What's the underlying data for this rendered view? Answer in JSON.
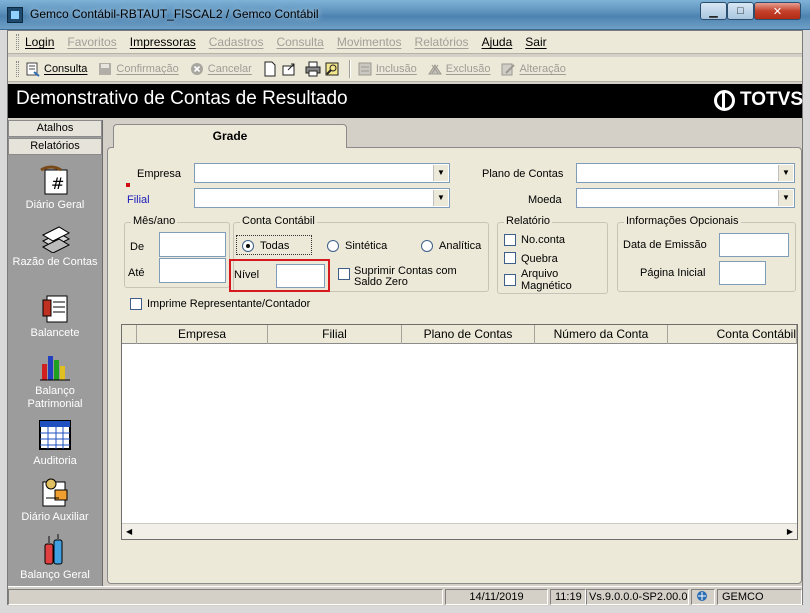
{
  "window": {
    "title": "Gemco Contábil-RBTAUT_FISCAL2 / Gemco Contábil",
    "minimize_label": "▁",
    "maximize_label": "□",
    "close_label": "✕"
  },
  "menu": {
    "items": [
      {
        "label": "Login",
        "enabled": true
      },
      {
        "label": "Favoritos",
        "enabled": false
      },
      {
        "label": "Impressoras",
        "enabled": true
      },
      {
        "label": "Cadastros",
        "enabled": false
      },
      {
        "label": "Consulta",
        "enabled": false
      },
      {
        "label": "Movimentos",
        "enabled": false
      },
      {
        "label": "Relatórios",
        "enabled": false
      },
      {
        "label": "Ajuda",
        "enabled": true
      },
      {
        "label": "Sair",
        "enabled": true
      }
    ]
  },
  "toolbar": {
    "consulta": "Consulta",
    "confirmacao": "Confirmação",
    "cancelar": "Cancelar",
    "inclusao": "Inclusão",
    "exclusao": "Exclusão",
    "alteracao": "Alteração"
  },
  "header": {
    "title": "Demonstrativo de Contas de Resultado",
    "brand": "TOTVS"
  },
  "left_panel": {
    "atalhos": "Atalhos",
    "relatorios": "Relatórios",
    "items": [
      {
        "label": "Diário Geral",
        "icon": "ledger-hash-icon"
      },
      {
        "label": "Razão de Contas",
        "icon": "stacked-books-icon"
      },
      {
        "label": "Balancete",
        "icon": "balance-sheet-icon"
      },
      {
        "label": "Balanço Patrimonial",
        "icon": "bar-chart-icon"
      },
      {
        "label": "Auditoria",
        "icon": "grid-table-icon"
      },
      {
        "label": "Diário Auxiliar",
        "icon": "auxiliary-journal-icon"
      },
      {
        "label": "Balanço Geral",
        "icon": "bottles-icon"
      }
    ]
  },
  "tab": {
    "label": "Grade"
  },
  "form": {
    "empresa_label": "Empresa",
    "filial_label": "Filial",
    "plano_contas_label": "Plano de Contas",
    "moeda_label": "Moeda",
    "mes_ano": {
      "title": "Mês/ano",
      "de_label": "De",
      "ate_label": "Até"
    },
    "conta_contabil": {
      "title": "Conta Contábil",
      "todas": "Todas",
      "sintetica": "Sintética",
      "analitica": "Analítica",
      "selected": "Todas",
      "nivel_label": "Nível",
      "suprimir_label": "Suprimir Contas com Saldo Zero"
    },
    "relatorio": {
      "title": "Relatório",
      "no_conta": "No.conta",
      "quebra": "Quebra",
      "arquivo_magnetico": "Arquivo Magnético"
    },
    "info_opcionais": {
      "title": "Informações Opcionais",
      "data_emissao_label": "Data de Emissão",
      "pagina_inicial_label": "Página Inicial"
    },
    "imprime_label": "Imprime Representante/Contador"
  },
  "grid": {
    "columns": [
      "Empresa",
      "Filial",
      "Plano de Contas",
      "Número da Conta",
      "Conta Contábil"
    ]
  },
  "status": {
    "date": "14/11/2019",
    "time": "11:19",
    "version": "Vs.9.0.0.0-SP2.00.0",
    "user": "GEMCO"
  }
}
